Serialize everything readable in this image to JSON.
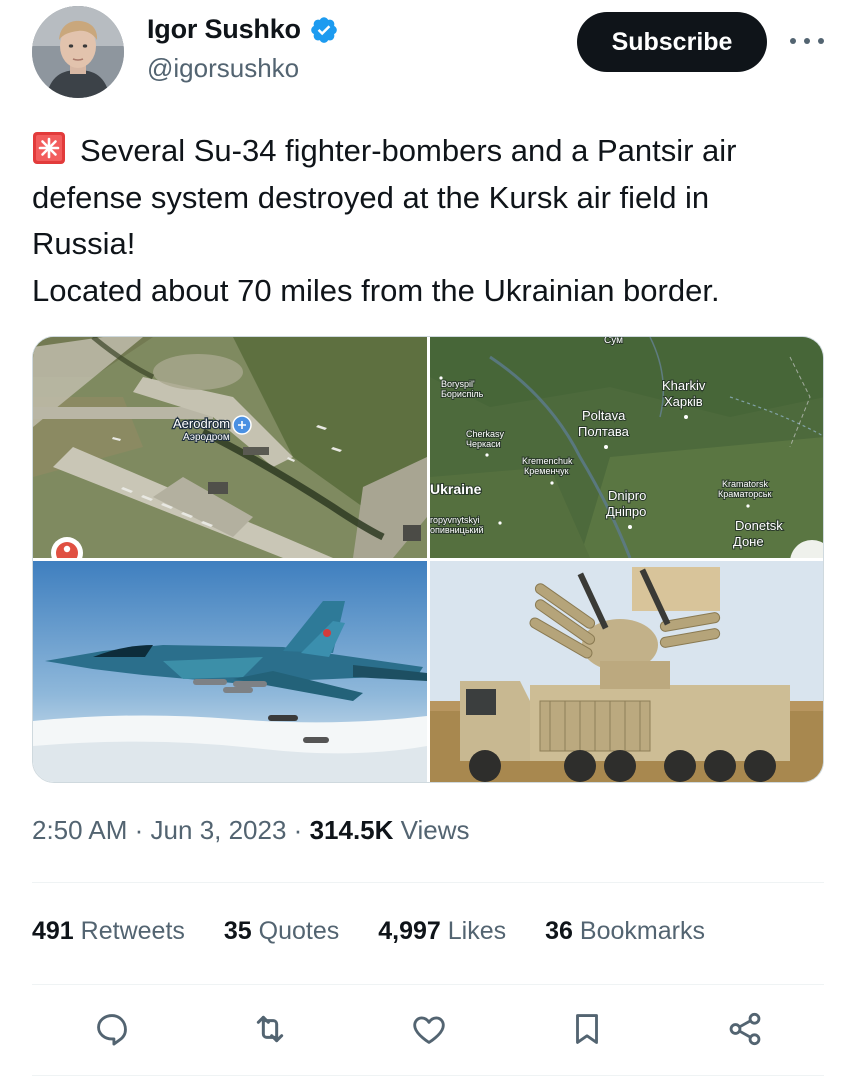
{
  "author": {
    "display_name": "Igor Sushko",
    "handle": "@igorsushko"
  },
  "header": {
    "subscribe_label": "Subscribe"
  },
  "tweet": {
    "lines": [
      "Several Su-34 fighter-bombers and a Pantsir air",
      "defense system destroyed at the Kursk air field in",
      "Russia!",
      "Located about 70 miles from the Ukrainian border."
    ]
  },
  "media": {
    "aerodrom_map": {
      "label_en": "Aerodrom",
      "label_ru": "Аэродром"
    },
    "region_map": {
      "places": [
        {
          "en": "Kharkiv",
          "ru": "Харків"
        },
        {
          "en": "Boryspil'",
          "ru": "Бориспіль"
        },
        {
          "en": "Poltava",
          "ru": "Полтава"
        },
        {
          "en": "Cherkasy",
          "ru": "Черкаси"
        },
        {
          "en": "Kremenchuk",
          "ru": "Кременчук"
        },
        {
          "en": "Dnipro",
          "ru": "Дніпро"
        },
        {
          "en": "Kramatorsk",
          "ru": "Краматорськ"
        },
        {
          "en": "Donetsk",
          "ru": "Доне"
        },
        {
          "en": "ropyvnytskyi",
          "ru": "опивницький"
        }
      ],
      "country": "Ukraine",
      "top_fragment": "Сум"
    }
  },
  "meta": {
    "time": "2:50 AM",
    "sep1": "·",
    "date": "Jun 3, 2023",
    "sep2": "·",
    "views_count": "314.5K",
    "views_label": "Views"
  },
  "stats": {
    "retweets_count": "491",
    "retweets_label": "Retweets",
    "quotes_count": "35",
    "quotes_label": "Quotes",
    "likes_count": "4,997",
    "likes_label": "Likes",
    "bookmarks_count": "36",
    "bookmarks_label": "Bookmarks"
  },
  "colors": {
    "accent": "#1d9bf0",
    "text_primary": "#0f1419",
    "text_secondary": "#536471",
    "button_dark": "#0f1419"
  },
  "icons": [
    "verified-badge-icon",
    "more-icon",
    "siren-emoji",
    "reply-icon",
    "retweet-icon",
    "like-icon",
    "bookmark-icon",
    "share-icon"
  ]
}
